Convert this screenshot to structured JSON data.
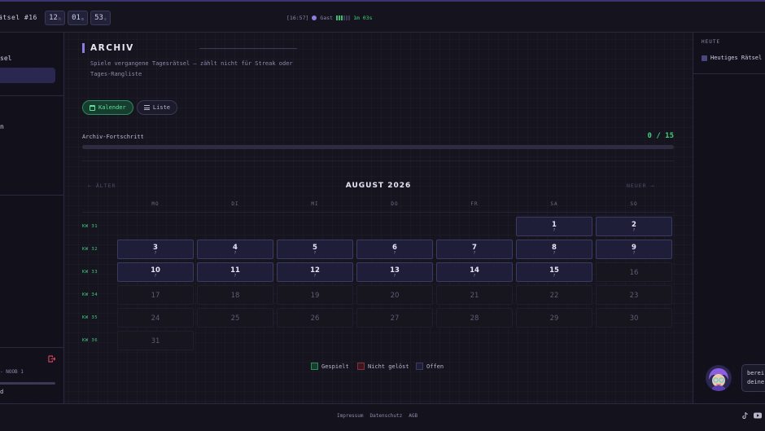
{
  "topbar": {
    "brand": "ätsel #16",
    "timer": [
      {
        "value": "12",
        "unit": "h"
      },
      {
        "value": "01",
        "unit": "m"
      },
      {
        "value": "53",
        "unit": "s"
      }
    ],
    "clock": "[16:57]",
    "user": "Gast",
    "countdown": "1m 03s",
    "accent_color": "#8c7de0"
  },
  "sidebar_left": {
    "item_1": "sel",
    "item_2": "n",
    "logout_icon": "logout-icon",
    "rank": "- NOOB 1",
    "bottom_text": "d"
  },
  "sidebar_right": {
    "heading": "HEUTE",
    "link": "Heutiges Rätsel"
  },
  "archive": {
    "title": "ARCHIV",
    "subtitle": "Spiele vergangene Tagesrätsel — zählt nicht für Streak oder Tages-Rangliste",
    "view_calendar": "Kalender",
    "view_list": "Liste",
    "progress_label": "Archiv-Fortschritt",
    "progress_text": "0 / 15",
    "progress_done": 0,
    "progress_total": 15,
    "nav_prev": "← ÄLTER",
    "nav_next": "NEUER →",
    "month": "AUGUST 2026",
    "weekdays": [
      "MO",
      "DI",
      "MI",
      "DO",
      "FR",
      "SA",
      "SO"
    ],
    "weeks": [
      "KW 31",
      "KW 32",
      "KW 33",
      "KW 34",
      "KW 35",
      "KW 36"
    ],
    "open_mark": "?",
    "days_played_available": [
      1,
      2,
      3,
      4,
      5,
      6,
      7,
      8,
      9,
      10,
      11,
      12,
      13,
      14,
      15
    ]
  },
  "legend": {
    "played": "Gespielt",
    "failed": "Nicht gelöst",
    "open": "Offen",
    "colors": {
      "played": "#2f8a5a",
      "failed": "#8a2f3a",
      "open": "#3b3a62"
    }
  },
  "footer": {
    "links": [
      "Impressum",
      "Datenschutz",
      "AGB"
    ],
    "icons": [
      "tiktok-icon",
      "youtube-icon"
    ]
  },
  "mascot": {
    "bubble_line1": "berei",
    "bubble_line2": "deine"
  }
}
